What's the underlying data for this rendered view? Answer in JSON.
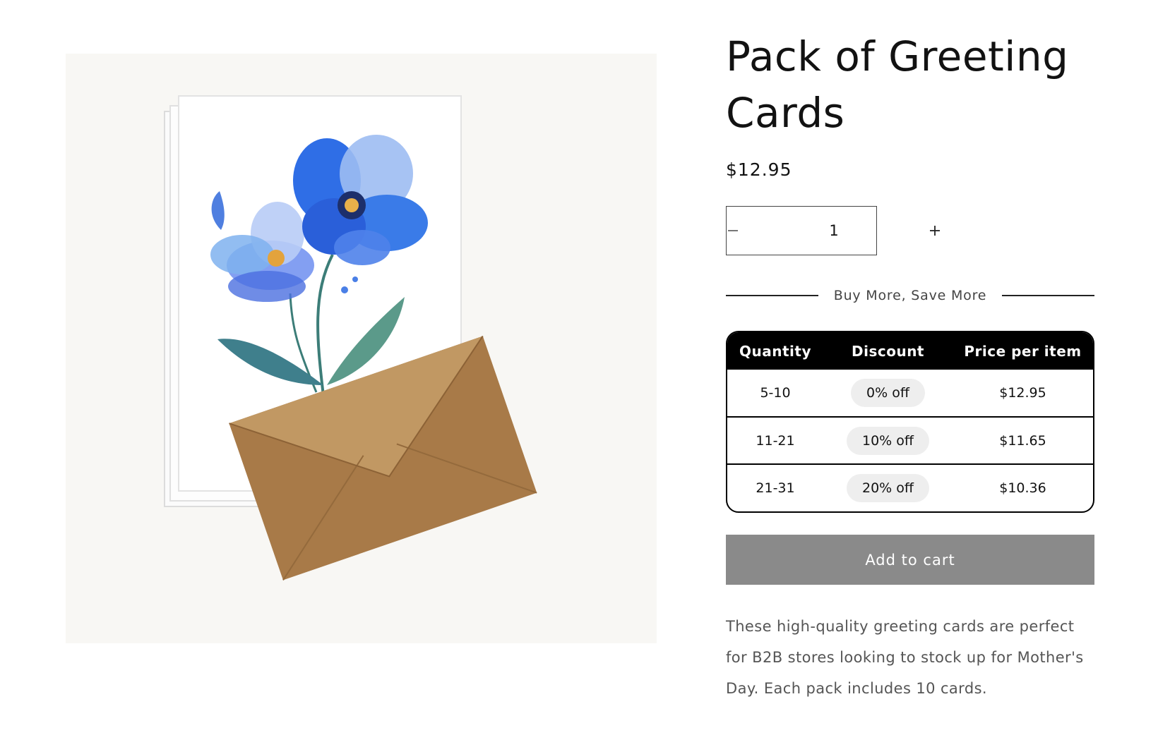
{
  "product": {
    "title": "Pack of Greeting Cards",
    "price": "$12.95",
    "image_alt": "Watercolor blue flower greeting cards with kraft envelope",
    "description": "These high-quality greeting cards are perfect for B2B stores looking to stock up for Mother's Day. Each pack includes 10 cards."
  },
  "quantity": {
    "value": "1",
    "decrease_icon": "minus-icon",
    "increase_icon": "plus-icon"
  },
  "volume_pricing": {
    "heading": "Buy More, Save More",
    "headers": [
      "Quantity",
      "Discount",
      "Price per item"
    ],
    "rows": [
      {
        "quantity": "5-10",
        "discount": "0% off",
        "price": "$12.95"
      },
      {
        "quantity": "11-21",
        "discount": "10% off",
        "price": "$11.65"
      },
      {
        "quantity": "21-31",
        "discount": "20% off",
        "price": "$10.36"
      }
    ]
  },
  "cart": {
    "label": "Add to cart",
    "button_color": "#8a8a8a"
  }
}
